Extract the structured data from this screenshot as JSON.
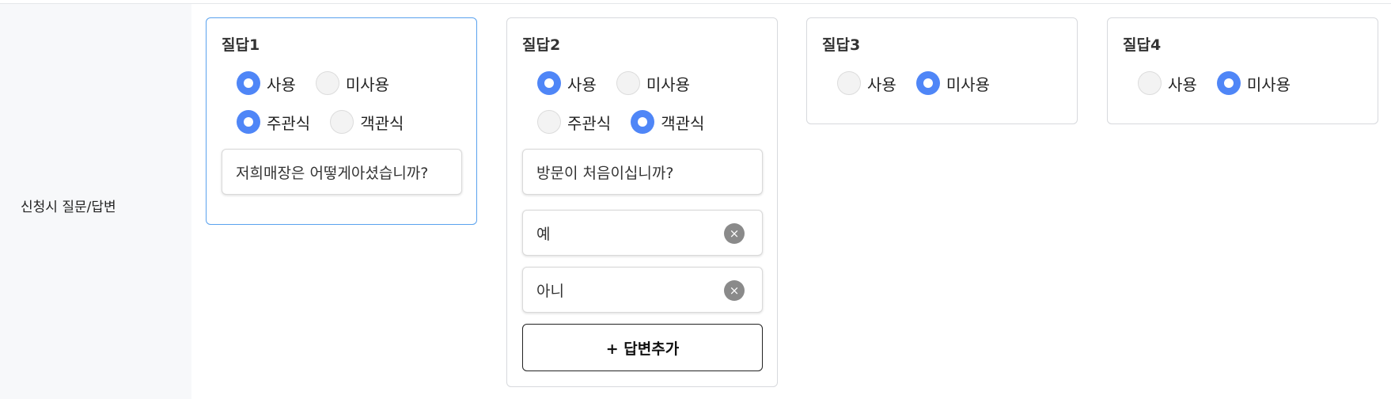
{
  "row_label": "신청시 질문/답변",
  "cards": [
    {
      "title": "질답1",
      "use_options": [
        {
          "label": "사용",
          "checked": true
        },
        {
          "label": "미사용",
          "checked": false
        }
      ],
      "type_options": [
        {
          "label": "주관식",
          "checked": true
        },
        {
          "label": "객관식",
          "checked": false
        }
      ],
      "question": "저희매장은 어떻게아셨습니까?"
    },
    {
      "title": "질답2",
      "use_options": [
        {
          "label": "사용",
          "checked": true
        },
        {
          "label": "미사용",
          "checked": false
        }
      ],
      "type_options": [
        {
          "label": "주관식",
          "checked": false
        },
        {
          "label": "객관식",
          "checked": true
        }
      ],
      "question": "방문이 처음이십니까?",
      "answers": [
        "예",
        "아니"
      ],
      "add_answer_label": "+ 답변추가",
      "clear_icon": "×"
    },
    {
      "title": "질답3",
      "use_options": [
        {
          "label": "사용",
          "checked": false
        },
        {
          "label": "미사용",
          "checked": true
        }
      ]
    },
    {
      "title": "질답4",
      "use_options": [
        {
          "label": "사용",
          "checked": false
        },
        {
          "label": "미사용",
          "checked": true
        }
      ]
    }
  ]
}
